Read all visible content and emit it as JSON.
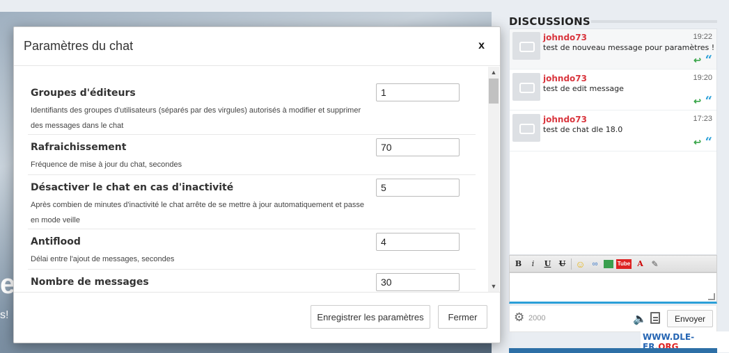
{
  "background": {
    "hero_big": "e",
    "hero_small": "s!"
  },
  "modal": {
    "title": "Paramètres du chat",
    "close": "x",
    "settings": [
      {
        "label": "Groupes d'éditeurs",
        "desc": "Identifiants des groupes d'utilisateurs (séparés par des virgules) autorisés à modifier et supprimer des messages dans le chat",
        "value": "1"
      },
      {
        "label": "Rafraichissement",
        "desc": "Fréquence de mise à jour du chat, secondes",
        "value": "70"
      },
      {
        "label": "Désactiver le chat en cas d'inactivité",
        "desc": "Après combien de minutes d'inactivité le chat arrête de se mettre à jour automatiquement et passe en mode veille",
        "value": "5"
      },
      {
        "label": "Antiflood",
        "desc": "Délai entre l'ajout de messages, secondes",
        "value": "4"
      },
      {
        "label": "Nombre de messages",
        "desc": "",
        "value": "30"
      }
    ],
    "save_label": "Enregistrer les paramètres",
    "close_label": "Fermer"
  },
  "chat": {
    "title": "DISCUSSIONS",
    "messages": [
      {
        "user": "johndo73",
        "time": "19:22",
        "text": "test de nouveau message pour paramètres !"
      },
      {
        "user": "johndo73",
        "time": "19:20",
        "text": "test de edit message"
      },
      {
        "user": "johndo73",
        "time": "17:23",
        "text": "test de chat dle 18.0"
      }
    ],
    "toolbar": {
      "bold": "B",
      "italic": "i",
      "underline": "U",
      "strike": "U",
      "youtube": "Tube",
      "color": "A"
    },
    "char_count": "2000",
    "send_label": "Envoyer"
  },
  "watermark": {
    "main": "WWW.DLE-FR.",
    "org": "ORG"
  },
  "colors": {
    "username": "#d9363e",
    "reply": "#3aa64a",
    "quote": "#2a9fd8",
    "accent": "#2a9fd8"
  }
}
